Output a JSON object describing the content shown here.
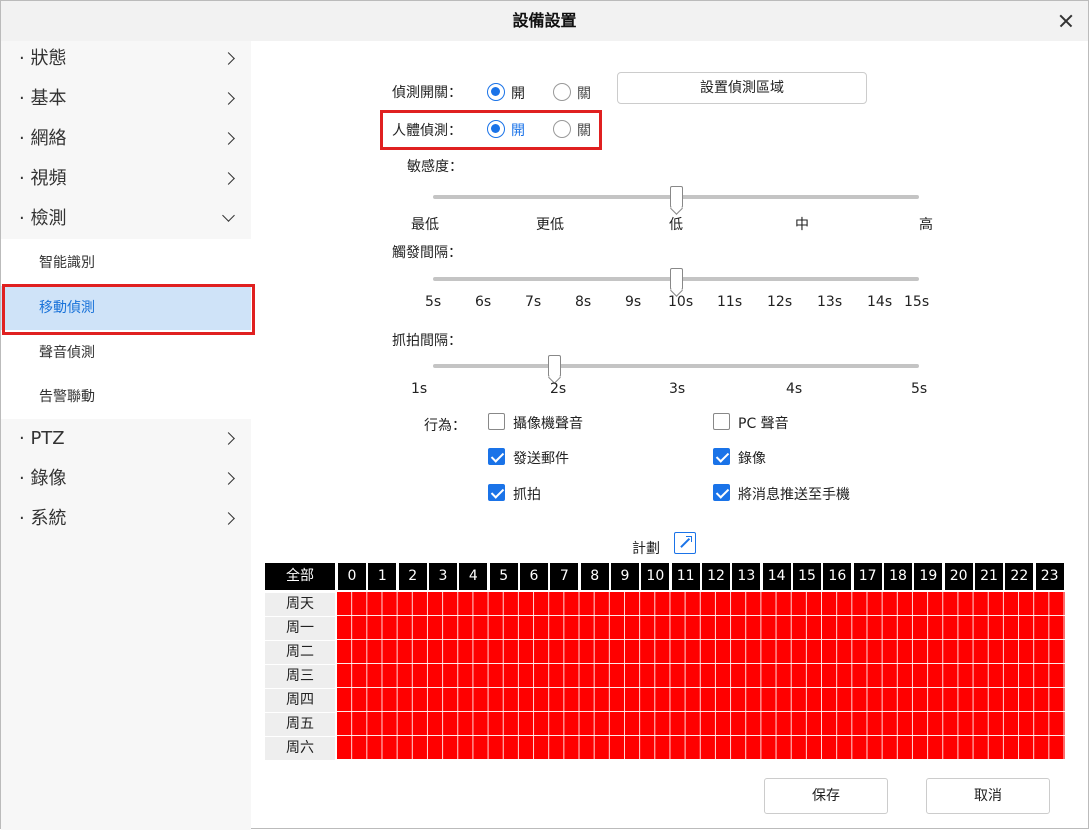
{
  "window": {
    "title": "設備設置"
  },
  "sidebar": {
    "top_items": [
      {
        "label": "· 狀態"
      },
      {
        "label": "· 基本"
      },
      {
        "label": "· 網絡"
      },
      {
        "label": "· 視頻"
      },
      {
        "label": "· 檢測"
      }
    ],
    "sub_items": [
      {
        "label": "智能識別"
      },
      {
        "label": "移動偵測",
        "active": true
      },
      {
        "label": "聲音偵測"
      },
      {
        "label": "告警聯動"
      }
    ],
    "bottom_items": [
      {
        "label": "· PTZ"
      },
      {
        "label": "· 錄像"
      },
      {
        "label": "· 系統"
      }
    ]
  },
  "detection": {
    "switch_label": "偵測開關：",
    "switch_on": "開",
    "switch_off": "關",
    "switch_value": "開",
    "set_area_button": "設置偵測區域",
    "human_label": "人體偵測：",
    "human_on": "開",
    "human_off": "關",
    "human_value": "開",
    "sensitivity_label": "敏感度：",
    "sensitivity_ticks": [
      "最低",
      "更低",
      "低",
      "中",
      "高"
    ],
    "sensitivity_value": "低",
    "trigger_label": "觸發間隔：",
    "trigger_ticks": [
      "5s",
      "6s",
      "7s",
      "8s",
      "9s",
      "10s",
      "11s",
      "12s",
      "13s",
      "14s",
      "15s"
    ],
    "trigger_value": "10s",
    "snap_label": "抓拍間隔：",
    "snap_ticks": [
      "1s",
      "2s",
      "3s",
      "4s",
      "5s"
    ],
    "snap_value": "2s",
    "action_label": "行為：",
    "actions": {
      "camera_sound": {
        "label": "攝像機聲音",
        "checked": false
      },
      "pc_sound": {
        "label": "PC 聲音",
        "checked": false
      },
      "send_email": {
        "label": "發送郵件",
        "checked": true
      },
      "record": {
        "label": "錄像",
        "checked": true
      },
      "snapshot": {
        "label": "抓拍",
        "checked": true
      },
      "push_phone": {
        "label": "將消息推送至手機",
        "checked": true
      }
    }
  },
  "schedule": {
    "title": "計劃",
    "all_label": "全部",
    "hours": [
      "0",
      "1",
      "2",
      "3",
      "4",
      "5",
      "6",
      "7",
      "8",
      "9",
      "10",
      "11",
      "12",
      "13",
      "14",
      "15",
      "16",
      "17",
      "18",
      "19",
      "20",
      "21",
      "22",
      "23"
    ],
    "days": [
      "周天",
      "周一",
      "周二",
      "周三",
      "周四",
      "周五",
      "周六"
    ],
    "all_selected": true,
    "selected_color": "#ff0000"
  },
  "footer": {
    "save": "保存",
    "cancel": "取消"
  },
  "colors": {
    "accent": "#1a73e8",
    "highlight_border": "#e02020",
    "active_bg": "#cfe3f8"
  }
}
